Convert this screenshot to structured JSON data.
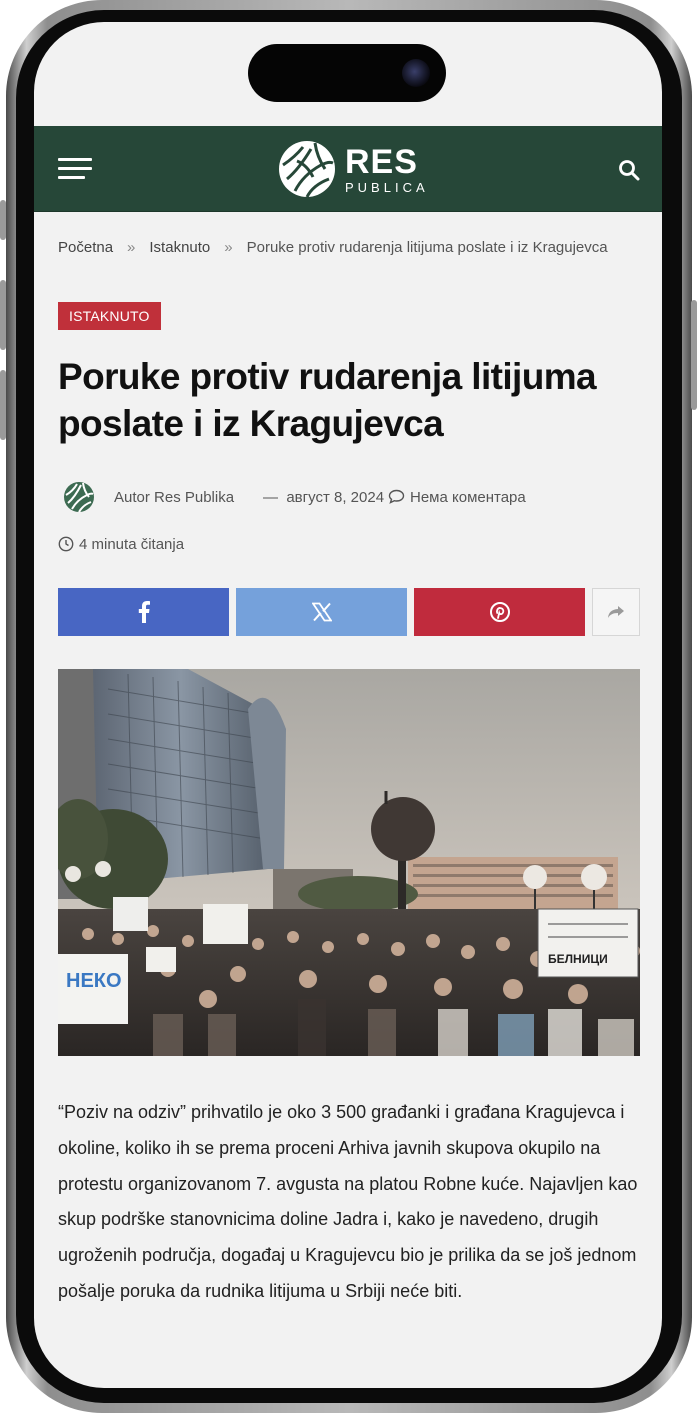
{
  "site": {
    "logo_main": "RES",
    "logo_sub": "PUBLICA",
    "header_color": "#264738"
  },
  "breadcrumb": {
    "items": [
      "Početna",
      "Istaknuto",
      "Poruke protiv rudarenja litijuma poslate i iz Kragujevca"
    ],
    "separator": "»"
  },
  "article": {
    "category": "ISTAKNUTO",
    "title": "Poruke protiv rudarenja litijuma poslate i iz Kragujevca",
    "author": "Autor Res Publika",
    "date_sep": "—",
    "date": "август 8, 2024",
    "comments": "Нема коментара",
    "read_time": "4 minuta čitanja",
    "body": "“Poziv na odziv” prihvatilo je oko 3 500 građanki i građana Kragujevca i okoline, koliko ih se prema proceni Arhiva javnih skupova okupilo na protestu organizovanom 7. avgusta na platou Robne kuće. Najavljen kao skup podrške stanovnicima doline Jadra i, kako je navedeno, drugih ugroženih područja, događaj u Kragujevcu bio je prilika da se još jednom pošalje poruka da rudnika litijuma u Srbiji neće biti."
  },
  "share": {
    "buttons": [
      {
        "name": "facebook",
        "icon": "facebook-icon",
        "color": "#4866c3"
      },
      {
        "name": "x",
        "icon": "x-icon",
        "color": "#75a1db"
      },
      {
        "name": "pinterest",
        "icon": "pinterest-icon",
        "color": "#c02b3d"
      },
      {
        "name": "more",
        "icon": "share-arrow-icon",
        "color": "#f5f5f5"
      }
    ]
  },
  "hero_image": {
    "signs": [
      "НЕКО",
      "БЕЛНИЦИ"
    ]
  }
}
